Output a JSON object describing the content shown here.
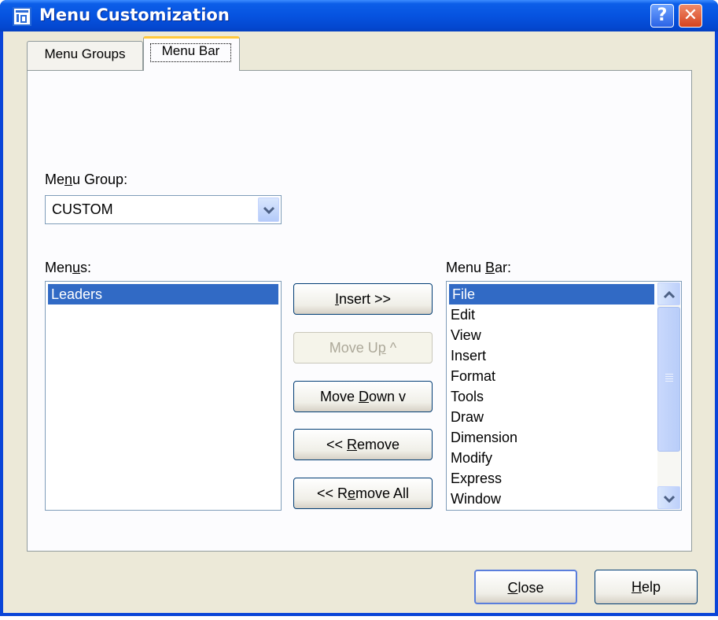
{
  "window": {
    "title": "Menu Customization"
  },
  "tabs": {
    "menu_groups": "Menu Groups",
    "menu_bar": "Menu Bar"
  },
  "menu_group": {
    "label_pre": "Me",
    "label_key": "n",
    "label_post": "u Group:",
    "value": "CUSTOM"
  },
  "menus": {
    "label_pre": "Men",
    "label_key": "u",
    "label_post": "s:",
    "items": [
      "Leaders"
    ]
  },
  "menu_bar": {
    "label_pre": "Menu ",
    "label_key": "B",
    "label_post": "ar:",
    "items": [
      "File",
      "Edit",
      "View",
      "Insert",
      "Format",
      "Tools",
      "Draw",
      "Dimension",
      "Modify",
      "Express",
      "Window"
    ]
  },
  "buttons": {
    "insert": {
      "pre": "",
      "key": "I",
      "post": "nsert >>"
    },
    "move_up": {
      "pre": "Move U",
      "key": "p",
      "post": " ^"
    },
    "move_down": {
      "pre": "Move ",
      "key": "D",
      "post": "own v"
    },
    "remove": {
      "pre": "<< ",
      "key": "R",
      "post": "emove"
    },
    "remove_all": {
      "pre": "<< R",
      "key": "e",
      "post": "move All"
    },
    "close": {
      "pre": "",
      "key": "C",
      "post": "lose"
    },
    "help": {
      "pre": "",
      "key": "H",
      "post": "elp"
    }
  },
  "icons": {
    "help": "help-icon",
    "close": "close-icon",
    "app": "app-icon",
    "dropdown": "chevron-down-icon",
    "scroll_up": "chevron-up-icon",
    "scroll_down": "chevron-down-icon"
  },
  "colors": {
    "titlebar": "#0653e0",
    "selection": "#316ac5",
    "dialog_bg": "#ece9d8",
    "tab_accent": "#ffc83c"
  }
}
